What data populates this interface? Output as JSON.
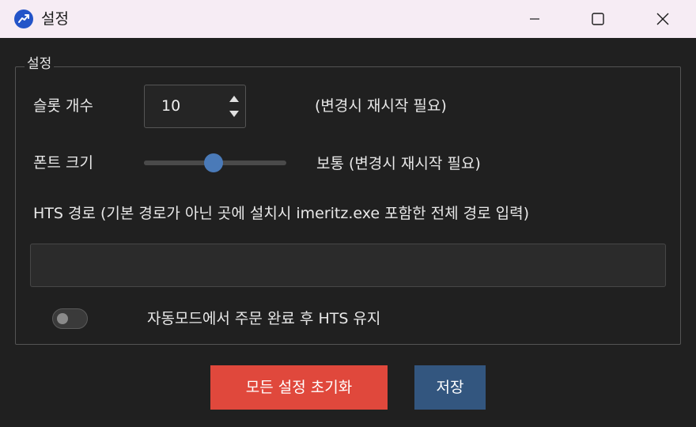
{
  "window": {
    "title": "설정",
    "icon": "trend-chart-icon",
    "controls": [
      "minimize-icon",
      "maximize-icon",
      "close-icon"
    ]
  },
  "settings_group": {
    "title": "설정",
    "slot_count": {
      "label": "슬롯 개수",
      "value": "10",
      "note": "(변경시 재시작 필요)"
    },
    "font_size": {
      "label": "폰트 크기",
      "value_text": "보통 (변경시 재시작 필요)",
      "slider_fraction": 0.49
    },
    "hts_path": {
      "label": "HTS 경로 (기본 경로가 아닌 곳에 설치시 imeritz.exe 포함한 전체 경로 입력)",
      "value": "",
      "placeholder": ""
    },
    "keep_hts": {
      "label": "자동모드에서 주문 완료 후 HTS 유지",
      "enabled": false
    }
  },
  "buttons": {
    "reset_label": "모든 설정 초기화",
    "save_label": "저장"
  },
  "colors": {
    "reset_button": "#e0483c",
    "save_button": "#33567f",
    "slider_thumb": "#4a7ab8",
    "app_icon": "#2354c8"
  }
}
